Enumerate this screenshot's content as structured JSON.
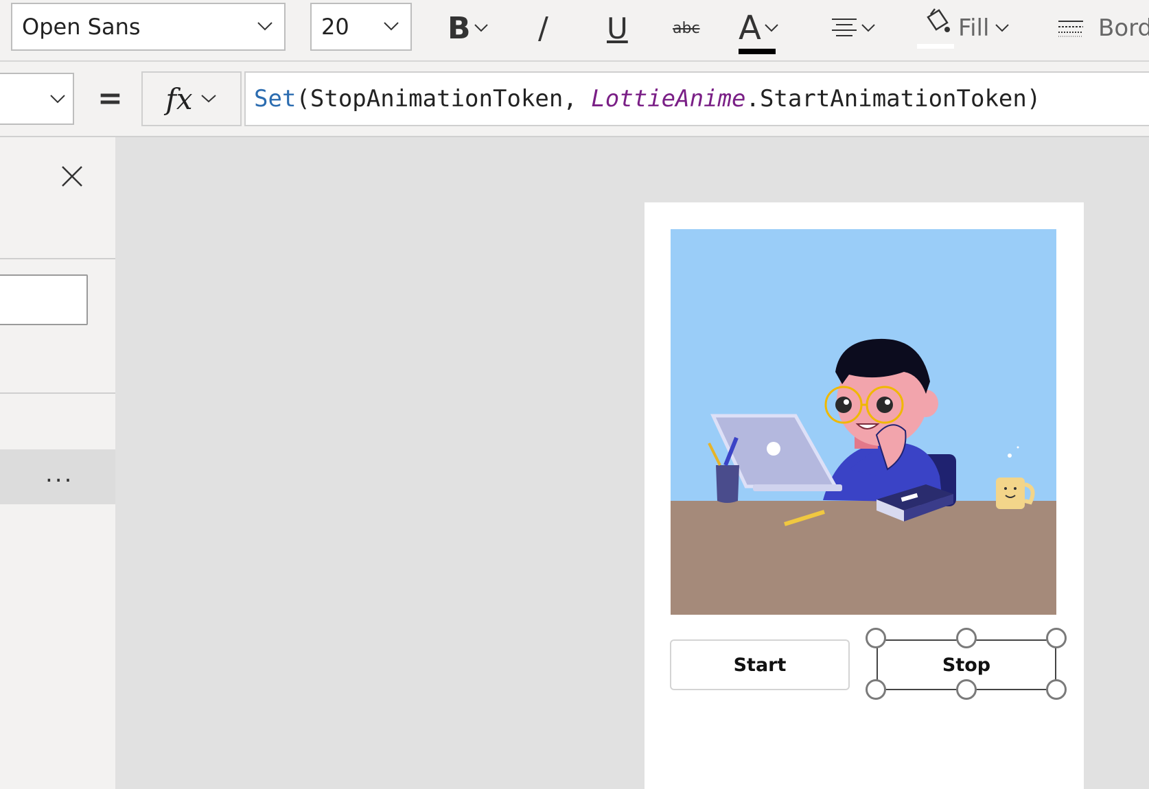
{
  "toolbar": {
    "font_family": "Open Sans",
    "font_size": "20",
    "bold_label": "B",
    "italic_label": "/",
    "underline_label": "U",
    "strikethrough_label": "abc",
    "font_color_label": "A",
    "fill_label": "Fill",
    "border_label": "Bord"
  },
  "formula_bar": {
    "equals": "=",
    "fx_label": "fx",
    "formula_func": "Set",
    "formula_open": "(StopAnimationToken, ",
    "formula_control": "LottieAnime",
    "formula_rest": ".StartAnimationToken)"
  },
  "left_panel": {
    "more_label": "..."
  },
  "screen": {
    "start_button": "Start",
    "stop_button": "Stop"
  },
  "colors": {
    "sky": "#9acdf8",
    "desk": "#a58a7a",
    "shirt": "#3a43c6",
    "accent_func": "#2b6cb0",
    "accent_control": "#7a1f86"
  },
  "icons": [
    "chevron-down-icon",
    "bold-icon",
    "italic-icon",
    "underline-icon",
    "strikethrough-icon",
    "font-color-icon",
    "align-icon",
    "fill-bucket-icon",
    "border-icon",
    "close-icon",
    "more-icon"
  ]
}
